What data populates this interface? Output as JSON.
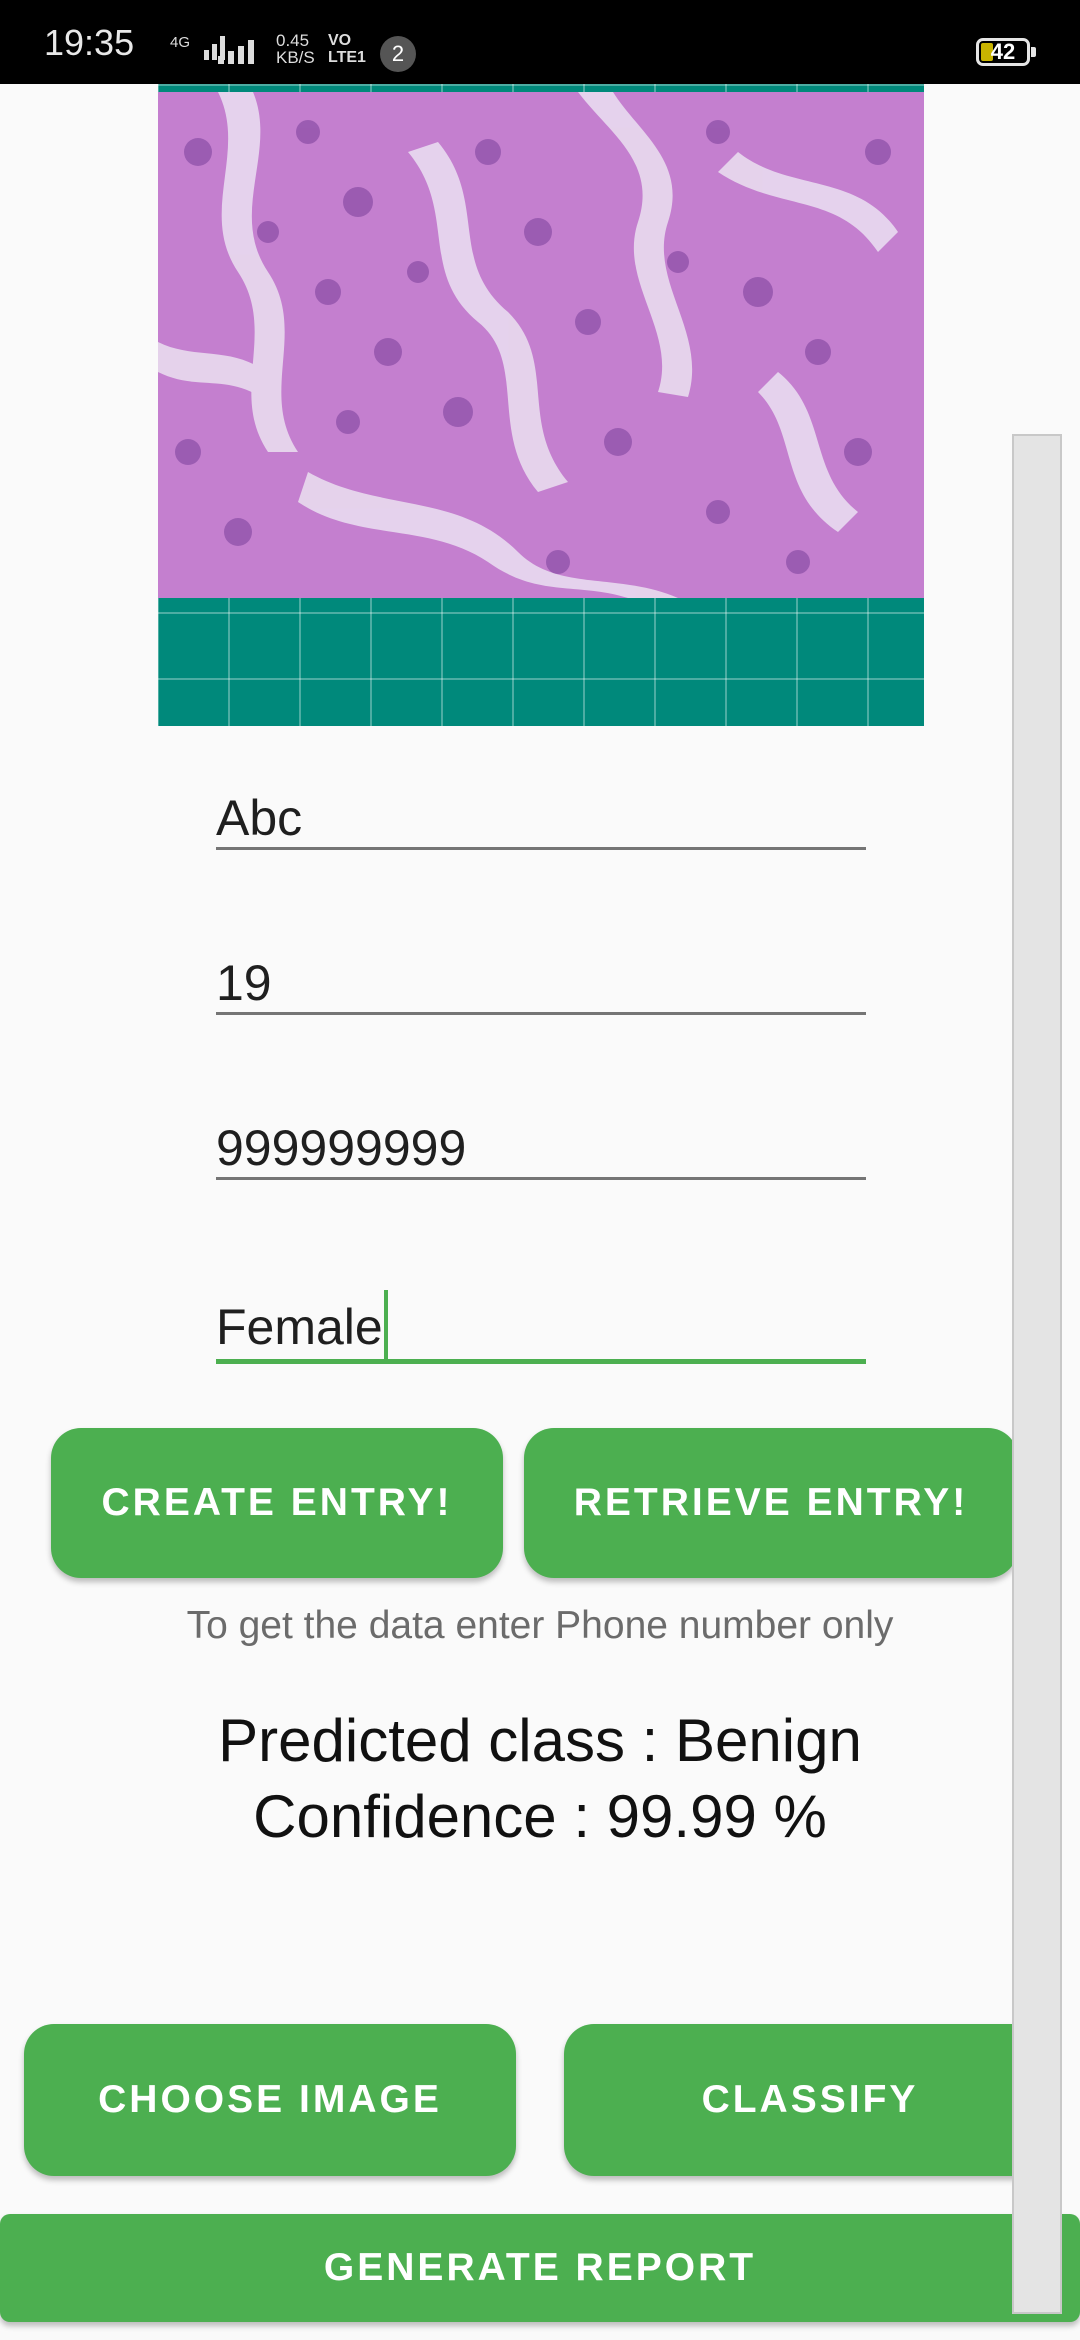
{
  "status_bar": {
    "time": "19:35",
    "network_type": "4G",
    "data_speed_value": "0.45",
    "data_speed_unit": "KB/S",
    "volte_line1": "VO",
    "volte_line2": "LTE1",
    "notification_count": "2",
    "battery_level": "42"
  },
  "form": {
    "name_value": "Abc",
    "age_value": "19",
    "phone_value": "999999999",
    "gender_value": "Female"
  },
  "buttons": {
    "create_entry": "CREATE ENTRY!",
    "retrieve_entry": "RETRIEVE ENTRY!",
    "choose_image": "CHOOSE IMAGE",
    "classify": "CLASSIFY",
    "generate_report": "GENERATE REPORT"
  },
  "hint_text": "To get the data enter Phone number only",
  "result": {
    "predicted_class": "Predicted class : Benign",
    "confidence": "Confidence : 99.99 %"
  },
  "colors": {
    "accent": "#4caf50",
    "image_background": "#00897b"
  }
}
